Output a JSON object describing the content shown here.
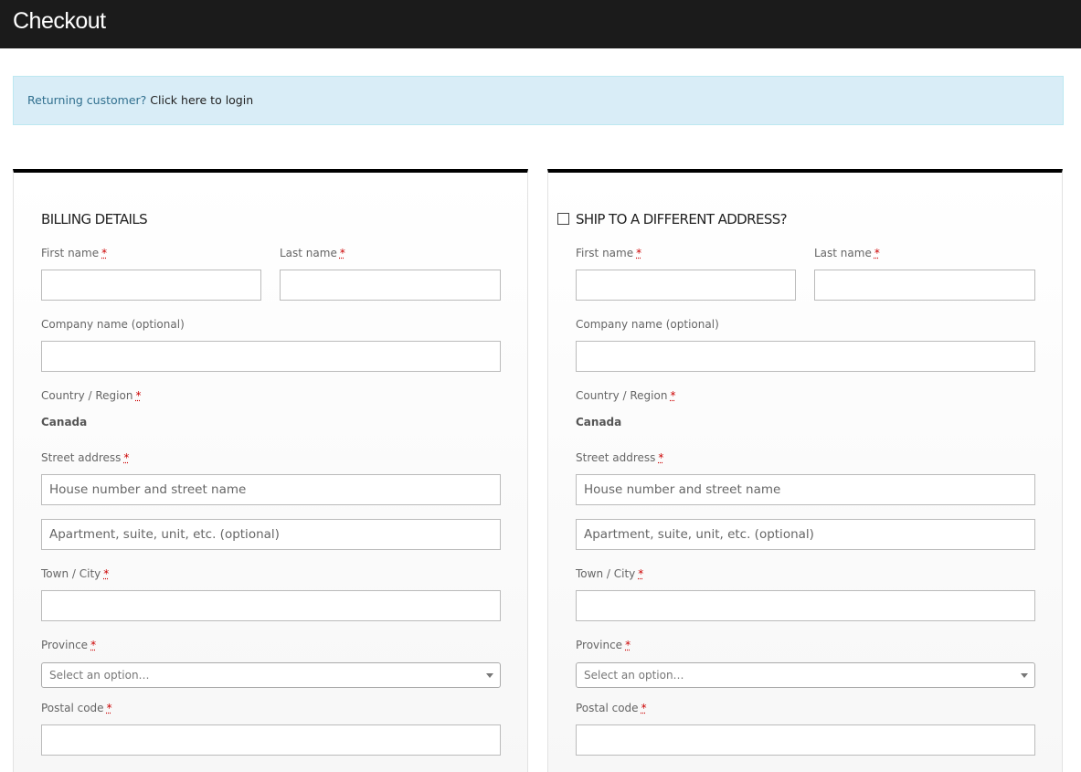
{
  "header": {
    "title": "Checkout"
  },
  "notice": {
    "prefix": "Returning customer?",
    "link": "Click here to login"
  },
  "required_mark": "*",
  "billing": {
    "title": "BILLING DETAILS",
    "first_name_label": "First name",
    "last_name_label": "Last name",
    "company_label": "Company name (optional)",
    "country_label": "Country / Region",
    "country_value": "Canada",
    "street_label": "Street address",
    "street_placeholder": "House number and street name",
    "apartment_placeholder": "Apartment, suite, unit, etc. (optional)",
    "city_label": "Town / City",
    "province_label": "Province",
    "province_select": "Select an option…",
    "postal_label": "Postal code"
  },
  "shipping": {
    "title": "SHIP TO A DIFFERENT ADDRESS?",
    "checked": false,
    "first_name_label": "First name",
    "last_name_label": "Last name",
    "company_label": "Company name (optional)",
    "country_label": "Country / Region",
    "country_value": "Canada",
    "street_label": "Street address",
    "street_placeholder": "House number and street name",
    "apartment_placeholder": "Apartment, suite, unit, etc. (optional)",
    "city_label": "Town / City",
    "province_label": "Province",
    "province_select": "Select an option…",
    "postal_label": "Postal code"
  },
  "colors": {
    "header_bg": "#1b1b1b",
    "notice_bg": "#d9edf7",
    "notice_text": "#31708f",
    "panel_border_top": "#000000",
    "required": "#cc0000"
  }
}
